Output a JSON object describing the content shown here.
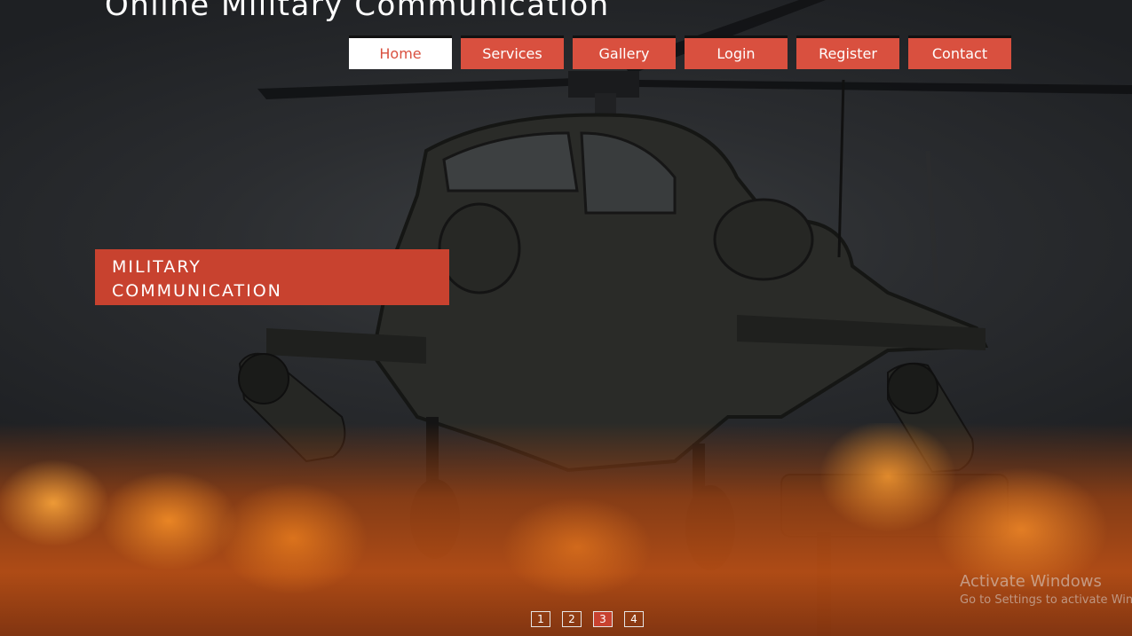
{
  "site": {
    "title": "Online Military Communication"
  },
  "nav": {
    "items": [
      {
        "label": "Home",
        "active": true
      },
      {
        "label": "Services",
        "active": false
      },
      {
        "label": "Gallery",
        "active": false
      },
      {
        "label": "Login",
        "active": false
      },
      {
        "label": "Register",
        "active": false
      },
      {
        "label": "Contact",
        "active": false
      }
    ]
  },
  "slide": {
    "line1": "MILITARY",
    "line2": "COMMUNICATION",
    "background": "attack-helicopter-over-explosions"
  },
  "pager": {
    "items": [
      "1",
      "2",
      "3",
      "4"
    ],
    "active_index": 2
  },
  "os_watermark": {
    "title": "Activate Windows",
    "subtitle": "Go to Settings to activate Windows."
  },
  "colors": {
    "accent": "#d9503f",
    "banner": "#c8422f",
    "text": "#ffffff"
  }
}
